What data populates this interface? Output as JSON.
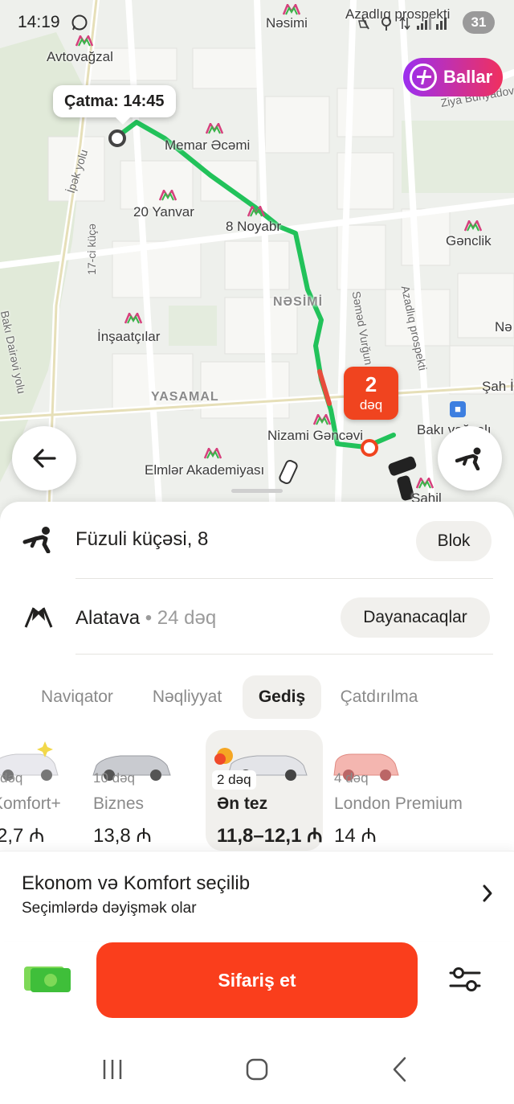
{
  "status_bar": {
    "time": "14:19",
    "battery": "31"
  },
  "map": {
    "pickup_label": "Çatma: 14:45",
    "ballar_label": "Ballar",
    "eta_value": "2",
    "eta_unit": "dəq",
    "labels": {
      "nesimi_top": "Nəsimi",
      "azadliq_top": "Azadlıq prospekti",
      "avtovagzal": "Avtovağzal",
      "ziya": "Ziya Bünyadov",
      "memar": "Memar Əcəmi",
      "ipek": "İpək yolu",
      "yanvar": "20 Yanvar",
      "noyabr": "8 Noyabr",
      "genclik": "Gənclik",
      "kuce17": "17-ci küçə",
      "nesimi_district": "NƏSİMİ",
      "samad": "Səməd Vurğun",
      "azadliq_side": "Azadlıq prospekti",
      "ne": "Nə",
      "dairevi": "Bakı Dairəvi yolu",
      "insaatcilar": "İnşaatçılar",
      "sah": "Şah İ",
      "yasamal": "YASAMAL",
      "nizami": "Nizami Gəncəvi",
      "baki_vagzal": "Bakı vağzalı",
      "elmler": "Elmlər Akademiyası",
      "sahil": "Sahil"
    }
  },
  "route": {
    "pickup": {
      "text": "Füzuli küçəsi, 8",
      "button": "Blok"
    },
    "destination": {
      "text": "Alatava",
      "duration": "• 24 dəq",
      "button": "Dayanacaqlar"
    }
  },
  "tabs": [
    "Naviqator",
    "Nəqliyyat",
    "Gediş",
    "Çatdırılma"
  ],
  "active_tab": "Gediş",
  "tariffs": [
    {
      "time": "dəq",
      "name": "Komfort+",
      "price": "2,7 ₼"
    },
    {
      "time": "10 dəq",
      "name": "Biznes",
      "price": "13,8 ₼"
    },
    {
      "time": "2 dəq",
      "name": "Ən tez",
      "price": "11,8–12,1 ₼",
      "selected": true
    },
    {
      "time": "4 dəq",
      "name": "London Premium",
      "price": "14 ₼"
    }
  ],
  "summary": {
    "title": "Ekonom və Komfort seçilib",
    "subtitle": "Seçimlərdə dəyişmək olar"
  },
  "order_button": "Sifariş et",
  "colors": {
    "route": "#22c25a",
    "accent": "#fa3e1c",
    "ballar_gradient_start": "#9b2ff0",
    "ballar_gradient_end": "#f0305e"
  }
}
